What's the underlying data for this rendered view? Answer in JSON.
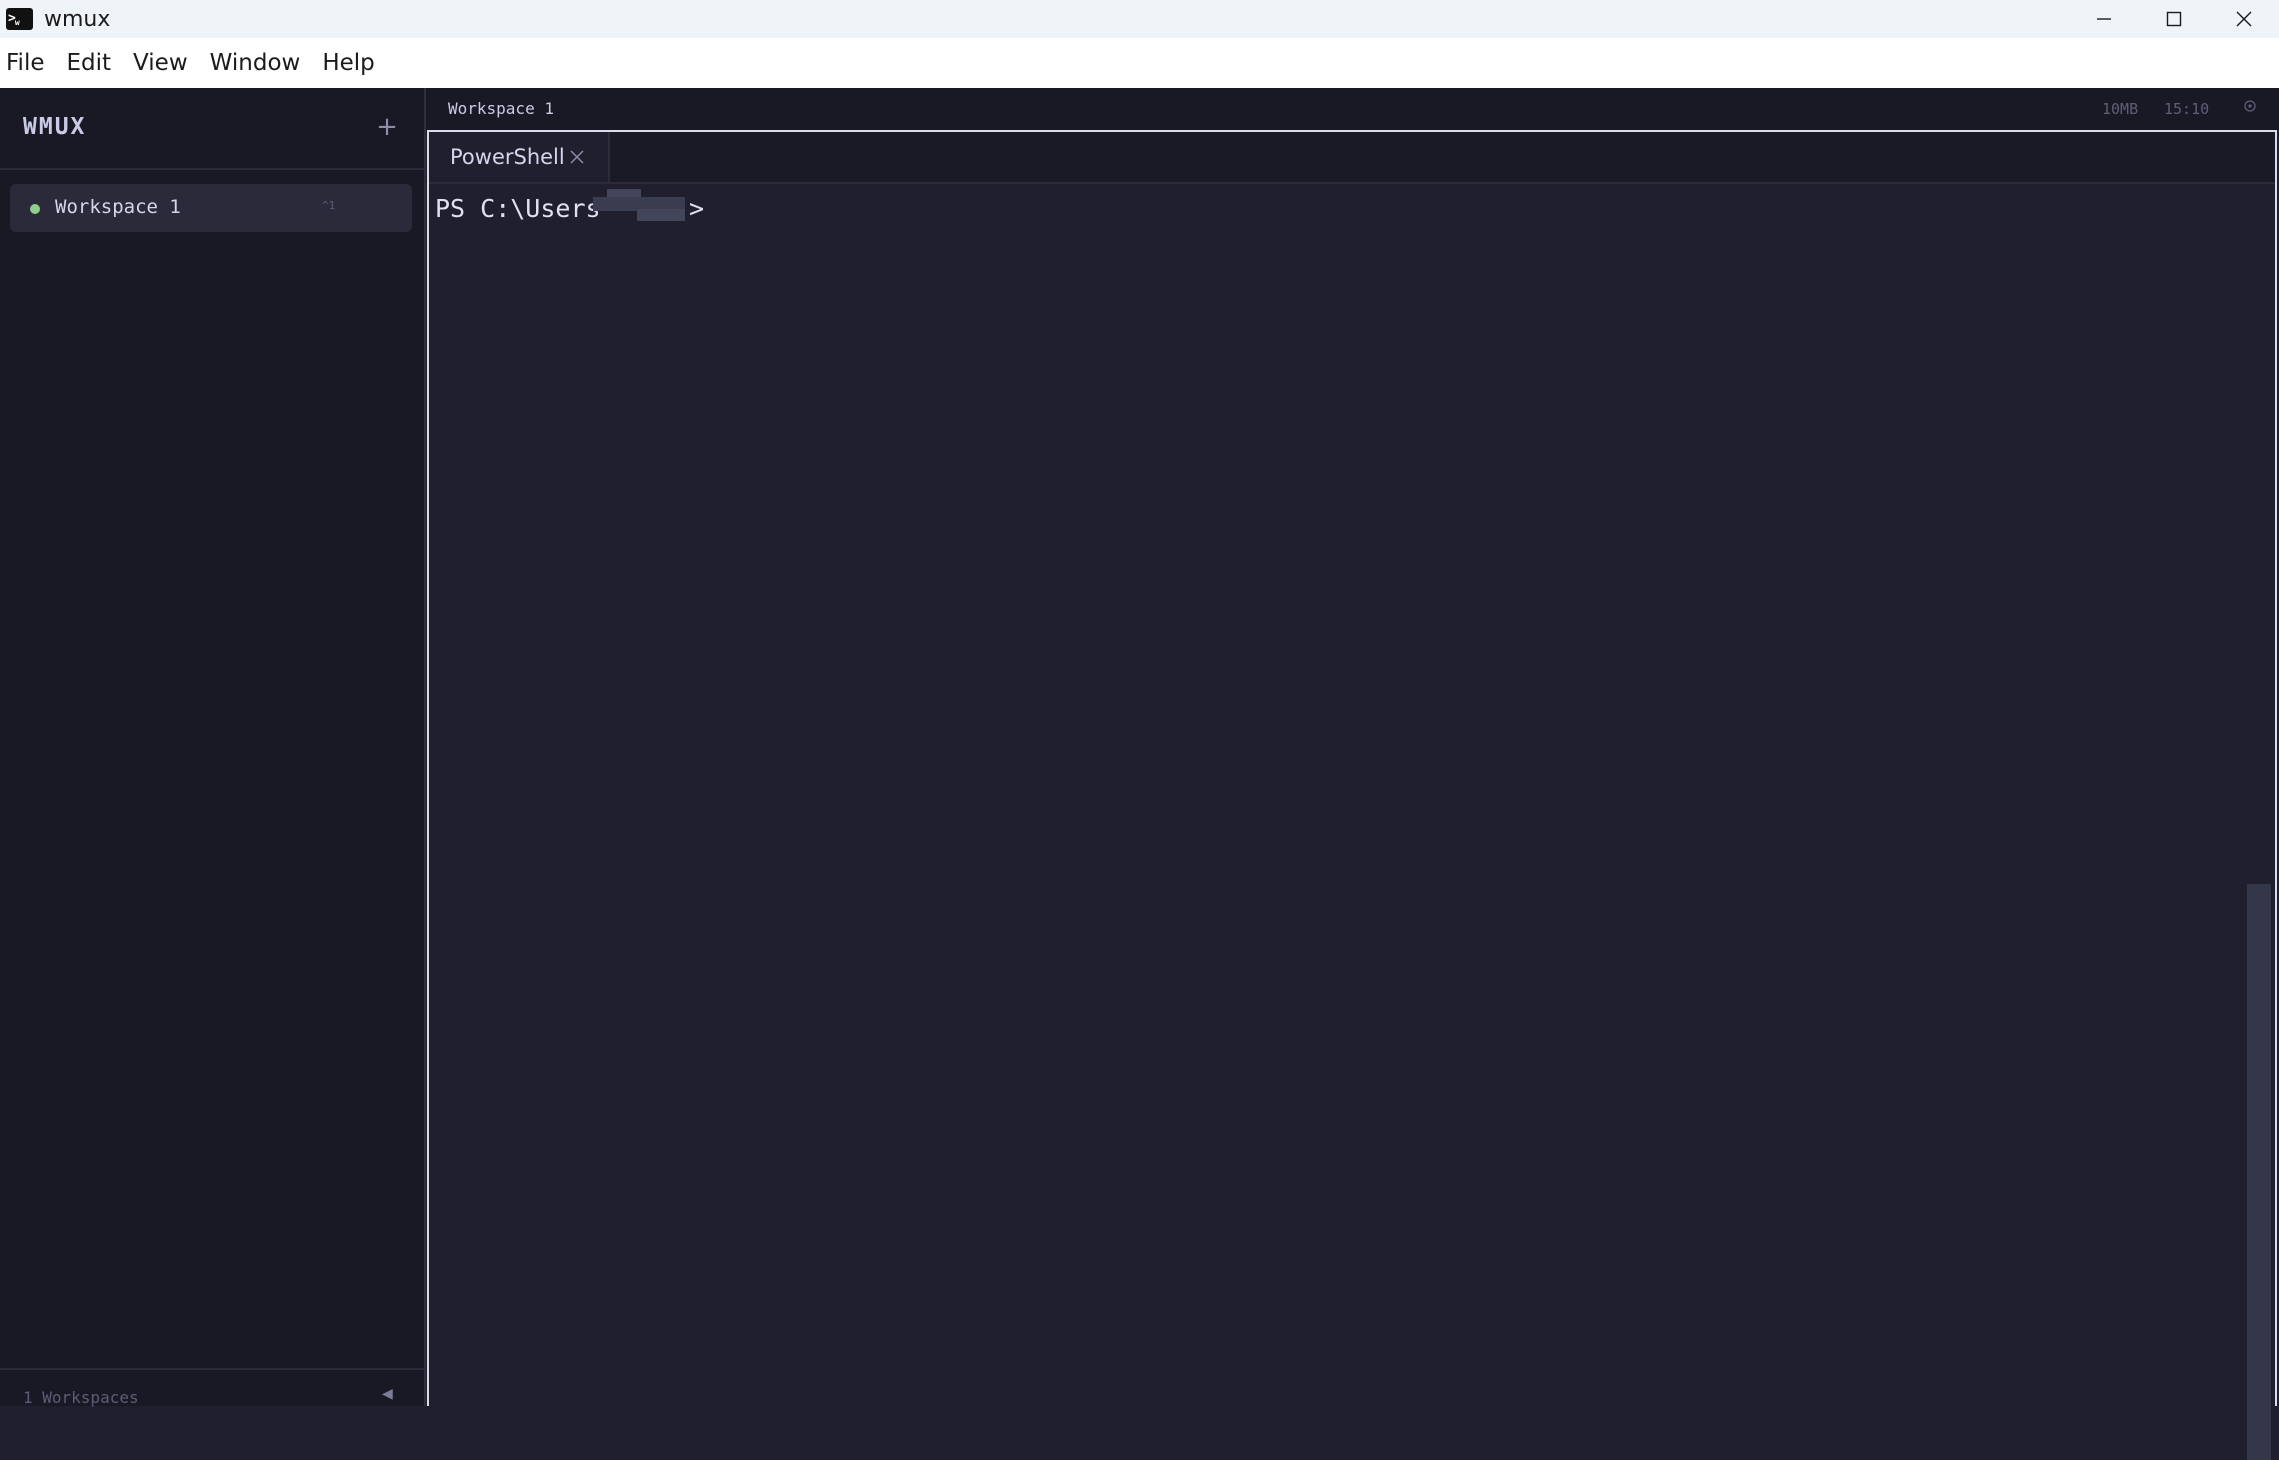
{
  "window": {
    "title": "wmux",
    "icon": "terminal-app-icon",
    "controls": [
      "minimize-icon",
      "maximize-icon",
      "close-icon"
    ]
  },
  "menu": [
    "File",
    "Edit",
    "View",
    "Window",
    "Help"
  ],
  "sidebar": {
    "brand": "WMUX",
    "add_label": "+",
    "workspaces": [
      {
        "label": "Workspace 1",
        "shortcut": "^1",
        "status_color": "#8fcf8a"
      }
    ],
    "footer": {
      "count": "1 Workspaces",
      "collapse_icon": "◀"
    }
  },
  "topbar": {
    "title": "Workspace 1",
    "memory": "10MB",
    "time": "15:10"
  },
  "tabs": [
    {
      "label": "PowerShell"
    }
  ],
  "terminal": {
    "prompt_prefix": "PS C:\\Users",
    "prompt_suffix": ">"
  },
  "colors": {
    "sidebar_bg": "#191926",
    "terminal_bg": "#1f1f2d",
    "accent_green": "#8fcf8a",
    "text": "#d4d6ee"
  }
}
